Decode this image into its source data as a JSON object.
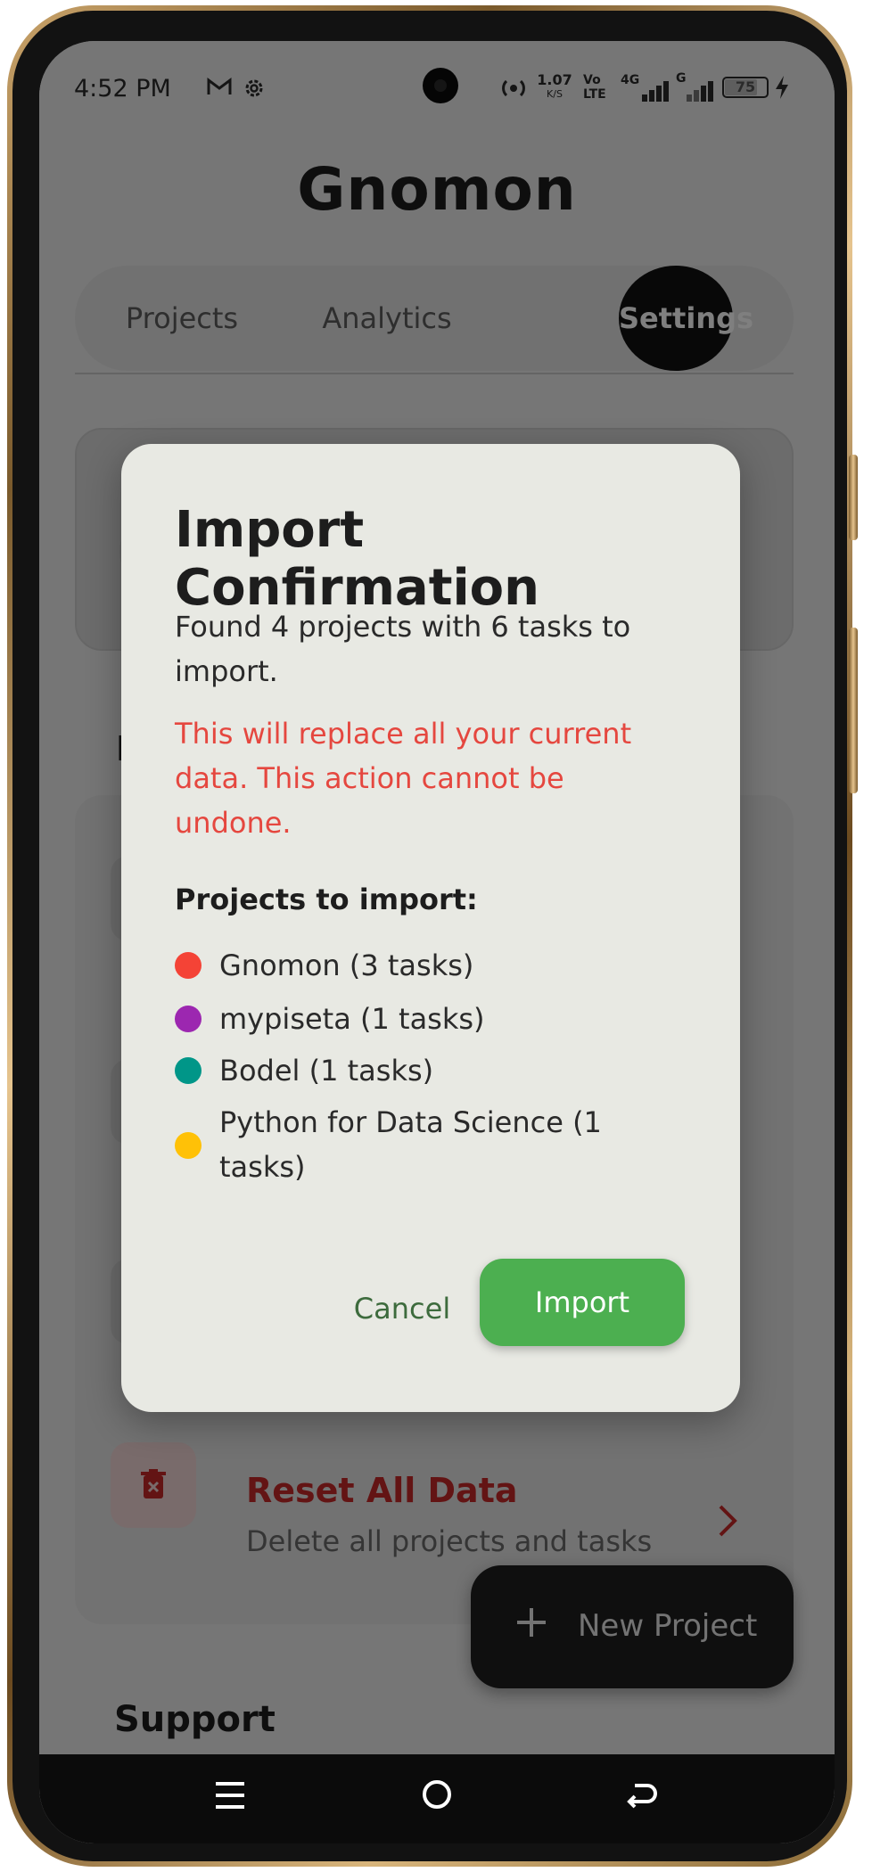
{
  "status_bar": {
    "time": "4:52 PM",
    "icons": [
      "gmail-icon",
      "settings-gear-icon"
    ],
    "net_speed_value": "1.07",
    "net_speed_unit": "K/S",
    "volte": "Vo LTE",
    "network1": "4G",
    "network2": "G",
    "battery": "75"
  },
  "app": {
    "title": "Gnomon",
    "tabs": [
      {
        "label": "Projects",
        "active": false
      },
      {
        "label": "Analytics",
        "active": false
      },
      {
        "label": "Settings",
        "active": true
      }
    ],
    "section_heading_partial": "D",
    "reset_row": {
      "title": "Reset All Data",
      "subtitle": "Delete all projects and tasks",
      "icon": "trash-icon"
    },
    "fab": {
      "icon": "plus-icon",
      "label": "New Project"
    },
    "support_heading": "Support"
  },
  "dialog": {
    "title": "Import Confirmation",
    "found_text": "Found 4 projects with 6 tasks to import.",
    "warning_text": "This will replace all your current data. This action cannot be undone.",
    "projects_heading": "Projects to import:",
    "projects": [
      {
        "label": "Gnomon (3 tasks)",
        "color": "#f44336"
      },
      {
        "label": "mypiseta (1 tasks)",
        "color": "#9c27b0"
      },
      {
        "label": "Bodel (1 tasks)",
        "color": "#009688"
      },
      {
        "label": "Python for Data Science (1 tasks)",
        "color": "#ffc107"
      }
    ],
    "cancel_label": "Cancel",
    "import_label": "Import",
    "colors": {
      "accent": "#4caf50",
      "warning": "#e5473f",
      "cancel_text": "#3d6b3d"
    }
  },
  "nav_bar": {
    "buttons": [
      "menu-icon",
      "home-icon",
      "back-icon"
    ]
  }
}
